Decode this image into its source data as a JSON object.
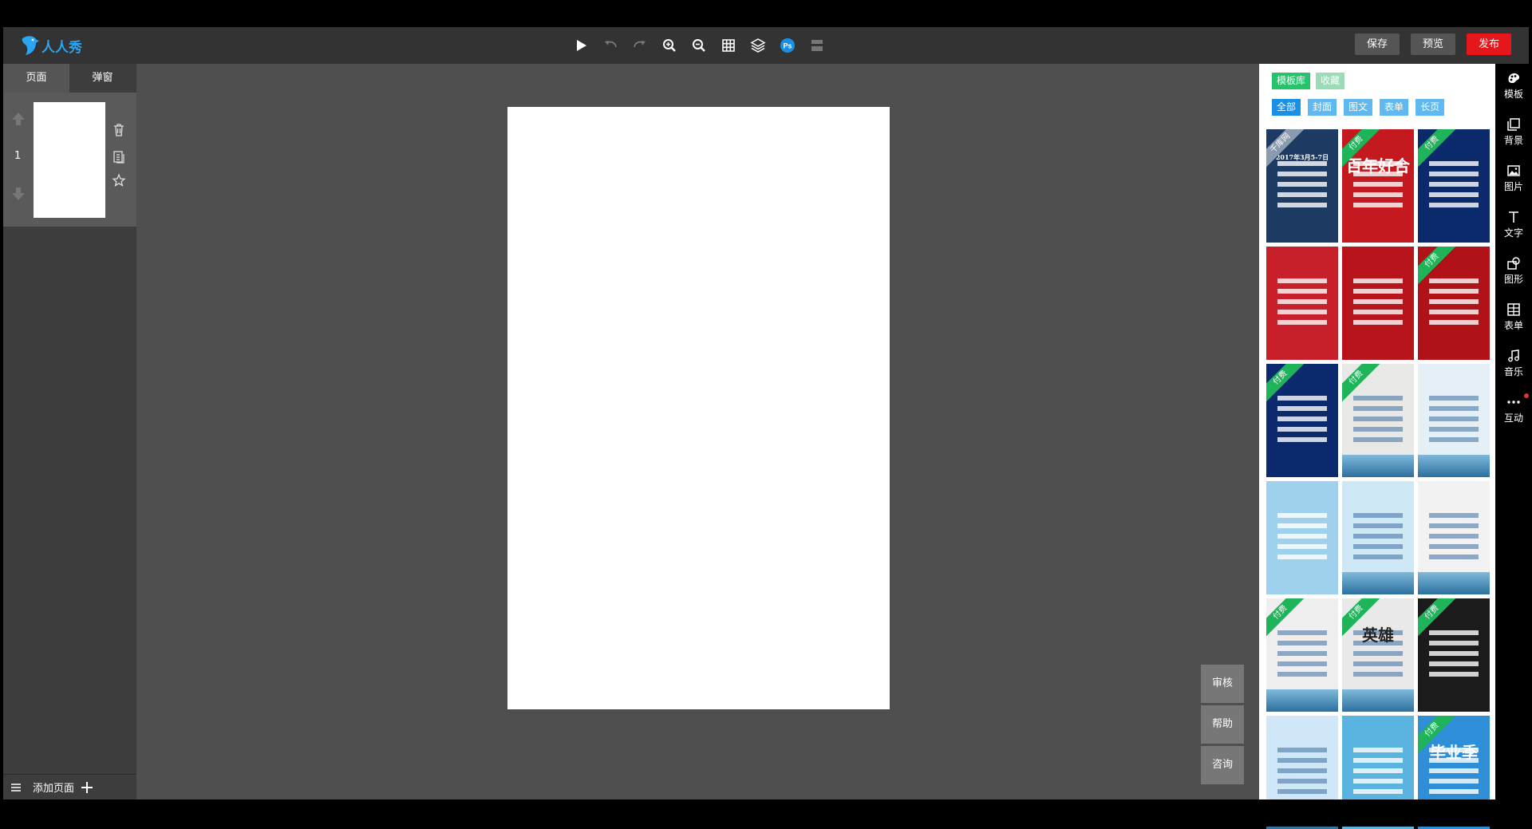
{
  "app": {
    "logo_text": "人人秀"
  },
  "toolbar": {
    "tools": [
      "play-icon",
      "undo-icon",
      "redo-icon",
      "zoom-in-icon",
      "zoom-out-icon",
      "grid-icon",
      "layers-icon",
      "ps-icon",
      "align-icon"
    ],
    "save_label": "保存",
    "preview_label": "预览",
    "publish_label": "发布"
  },
  "left_panel": {
    "tabs": [
      {
        "label": "页面",
        "active": true
      },
      {
        "label": "弹窗",
        "active": false
      }
    ],
    "pages": [
      {
        "number": "1"
      }
    ],
    "add_page_label": "添加页面"
  },
  "float_buttons": {
    "review": "审核",
    "help": "帮助",
    "consult": "咨询"
  },
  "template_panel": {
    "tabs": [
      {
        "label": "模板库",
        "active": true
      },
      {
        "label": "收藏",
        "active": false
      }
    ],
    "filters": [
      {
        "label": "全部",
        "active": true
      },
      {
        "label": "封面",
        "active": false
      },
      {
        "label": "图文",
        "active": false
      },
      {
        "label": "表单",
        "active": false
      },
      {
        "label": "长页",
        "active": false
      }
    ],
    "templates": [
      {
        "ribbon": "千库网",
        "bg": "#1d3a63",
        "text": "2017年3月5-7日"
      },
      {
        "ribbon": "付费",
        "bg": "#c41a1f",
        "text": "百年好合"
      },
      {
        "ribbon": "付费",
        "bg": "#0a2a6b",
        "text": ""
      },
      {
        "ribbon": "",
        "bg": "#c8202a",
        "text": ""
      },
      {
        "ribbon": "",
        "bg": "#b8141c",
        "text": ""
      },
      {
        "ribbon": "付费",
        "bg": "#b01218",
        "text": ""
      },
      {
        "ribbon": "付费",
        "bg": "#0b2a6e",
        "text": ""
      },
      {
        "ribbon": "付费",
        "bg": "#e8e8e6",
        "text": ""
      },
      {
        "ribbon": "",
        "bg": "#e4f0f6",
        "text": ""
      },
      {
        "ribbon": "",
        "bg": "#9fd0ec",
        "text": ""
      },
      {
        "ribbon": "",
        "bg": "#cfe8f5",
        "text": ""
      },
      {
        "ribbon": "",
        "bg": "#f2f2f2",
        "text": ""
      },
      {
        "ribbon": "付费",
        "bg": "#efefef",
        "text": ""
      },
      {
        "ribbon": "付费",
        "bg": "#e9e9e9",
        "text": "英雄"
      },
      {
        "ribbon": "付费",
        "bg": "#1b1b1b",
        "text": ""
      },
      {
        "ribbon": "",
        "bg": "#cfe7f6",
        "text": ""
      },
      {
        "ribbon": "",
        "bg": "#5bb3e0",
        "text": ""
      },
      {
        "ribbon": "付费",
        "bg": "#2e8fd8",
        "text": "毕业季"
      }
    ]
  },
  "rail": {
    "items": [
      {
        "icon": "template-icon",
        "label": "模板"
      },
      {
        "icon": "background-icon",
        "label": "背景"
      },
      {
        "icon": "image-icon",
        "label": "图片"
      },
      {
        "icon": "text-icon",
        "label": "文字"
      },
      {
        "icon": "shape-icon",
        "label": "图形"
      },
      {
        "icon": "form-icon",
        "label": "表单"
      },
      {
        "icon": "music-icon",
        "label": "音乐"
      },
      {
        "icon": "more-icon",
        "label": "互动"
      }
    ]
  },
  "colors": {
    "accent_green": "#25c36a",
    "accent_blue": "#1a8fe6",
    "publish_red": "#e6161a",
    "logo_blue": "#2ba4f2"
  }
}
